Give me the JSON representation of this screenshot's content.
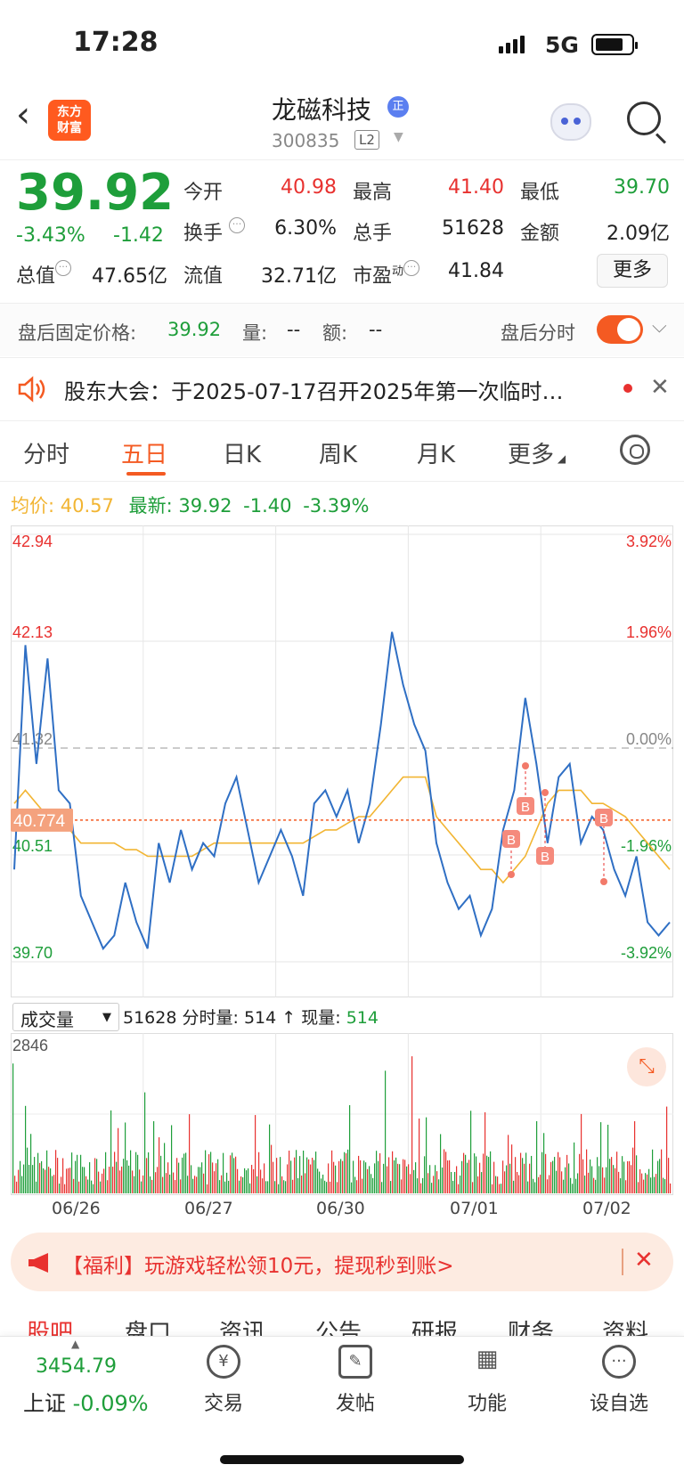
{
  "status": {
    "time": "17:28",
    "network": "5G"
  },
  "header": {
    "logo": "东方\n财富",
    "title": "龙磁科技",
    "badge": "正",
    "code": "300835",
    "level": "L2"
  },
  "quote": {
    "price": "39.92",
    "change_pct": "-3.43%",
    "change_amt": "-1.42",
    "open_label": "今开",
    "open": "40.98",
    "high_label": "最高",
    "high": "41.40",
    "low_label": "最低",
    "low": "39.70",
    "turnover_label": "换手",
    "turnover": "6.30%",
    "volume_label": "总手",
    "volume": "51628",
    "amount_label": "金额",
    "amount": "2.09亿",
    "mktcap_label": "总值",
    "mktcap": "47.65亿",
    "float_label": "流值",
    "float": "32.71亿",
    "pe_label": "市盈",
    "pe_sup": "动",
    "pe": "41.84",
    "more": "更多"
  },
  "after_hours": {
    "fixed_price_label": "盘后固定价格:",
    "fixed_price": "39.92",
    "vol_label": "量:",
    "vol": "--",
    "amt_label": "额:",
    "amt": "--",
    "timeshare_label": "盘后分时"
  },
  "notice": {
    "text": "股东大会：于2025-07-17召开2025年第一次临时…"
  },
  "tabs": [
    "分时",
    "五日",
    "日K",
    "周K",
    "月K",
    "更多"
  ],
  "info": {
    "avg_label": "均价:",
    "avg": "40.57",
    "latest_label": "最新:",
    "latest": "39.92",
    "latest_chg": "-1.40",
    "latest_pct": "-3.39%"
  },
  "chart_data": {
    "type": "line",
    "title": "",
    "y_left_ticks": [
      "42.94",
      "42.13",
      "41.32",
      "40.51",
      "39.70"
    ],
    "y_right_ticks": [
      "3.92%",
      "1.96%",
      "0.00%",
      "-1.96%",
      "-3.92%"
    ],
    "current_price_tag": "40.774",
    "x_labels": [
      "06/26",
      "06/27",
      "06/30",
      "07/01",
      "07/02"
    ],
    "ylim": [
      39.7,
      42.94
    ],
    "prev_close": 41.32,
    "series": [
      {
        "name": "price",
        "values": [
          40.4,
          42.1,
          41.2,
          42.0,
          41.0,
          40.9,
          40.2,
          40.0,
          39.8,
          39.9,
          40.3,
          40.0,
          39.8,
          40.6,
          40.3,
          40.7,
          40.4,
          40.6,
          40.5,
          40.9,
          41.1,
          40.7,
          40.3,
          40.5,
          40.7,
          40.5,
          40.2,
          40.9,
          41.0,
          40.8,
          41.0,
          40.6,
          40.9,
          41.5,
          42.2,
          41.8,
          41.5,
          41.3,
          40.6,
          40.3,
          40.1,
          40.2,
          39.9,
          40.1,
          40.7,
          41.0,
          41.7,
          41.2,
          40.6,
          41.1,
          41.2,
          40.6,
          40.8,
          40.7,
          40.4,
          40.2,
          40.5,
          40.0,
          39.9,
          40.0
        ]
      },
      {
        "name": "avg",
        "values": [
          40.9,
          41.0,
          40.9,
          40.8,
          40.8,
          40.7,
          40.6,
          40.6,
          40.6,
          40.6,
          40.55,
          40.55,
          40.5,
          40.5,
          40.5,
          40.5,
          40.5,
          40.55,
          40.6,
          40.6,
          40.6,
          40.6,
          40.6,
          40.6,
          40.6,
          40.6,
          40.6,
          40.65,
          40.7,
          40.7,
          40.75,
          40.8,
          40.8,
          40.9,
          41.0,
          41.1,
          41.1,
          41.1,
          40.8,
          40.7,
          40.6,
          40.5,
          40.4,
          40.4,
          40.3,
          40.4,
          40.5,
          40.7,
          40.9,
          41.0,
          41.0,
          41.0,
          40.9,
          40.9,
          40.85,
          40.8,
          40.7,
          40.6,
          40.5,
          40.4
        ]
      }
    ],
    "buy_marks": [
      "B",
      "B",
      "B",
      "B"
    ]
  },
  "volume": {
    "selector": "成交量",
    "total": "51628",
    "minute_label": "分时量:",
    "minute": "514",
    "arrow": "↑",
    "now_label": "现量:",
    "now": "514",
    "max_tick": "2846"
  },
  "promo": {
    "text": "【福利】玩游戏轻松领10元，提现秒到账>"
  },
  "sub_tabs": [
    "股吧",
    "盘口",
    "资讯",
    "公告",
    "研报",
    "财务",
    "资料"
  ],
  "bottom": {
    "index_value": "3454.79",
    "index_name": "上证",
    "index_pct": "-0.09%",
    "items": [
      "交易",
      "发帖",
      "功能",
      "设自选"
    ]
  },
  "colors": {
    "up": "#e8312f",
    "down": "#1e9e3a",
    "accent": "#f45a22",
    "line": "#2f6fc4",
    "avg": "#f2b533"
  }
}
